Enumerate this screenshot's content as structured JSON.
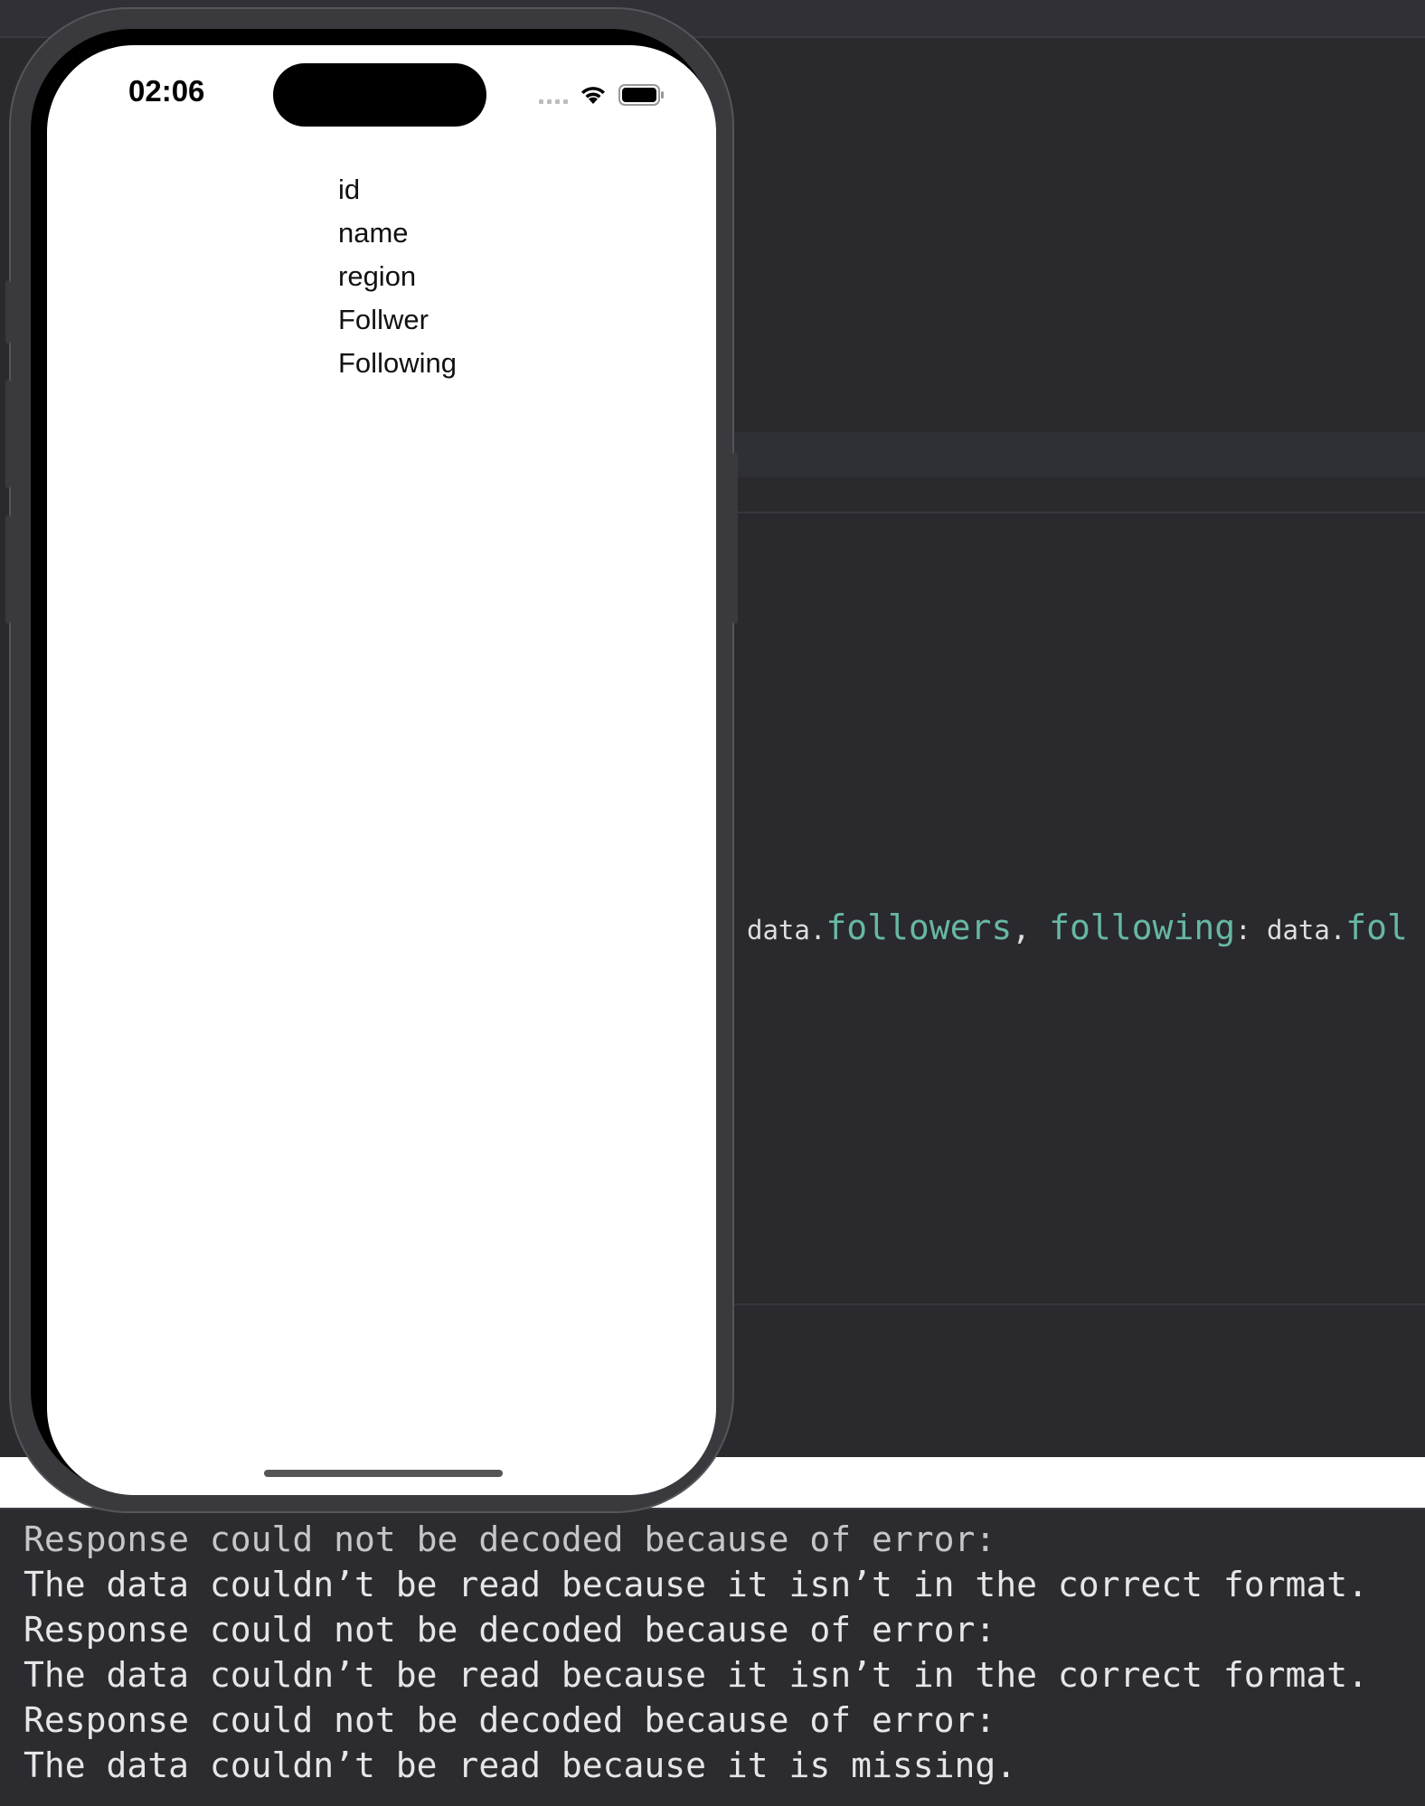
{
  "simulator": {
    "status_bar": {
      "time": "02:06",
      "icons": [
        "cellular-signal-icon",
        "wifi-icon",
        "battery-icon"
      ]
    },
    "fields": [
      "id",
      "name",
      "region",
      "Follwer",
      "Following"
    ]
  },
  "editor": {
    "code_line": {
      "part1": "data.",
      "part2": "followers",
      "part3": ", ",
      "part4": "following",
      "part5": ": data.",
      "part6": "fol"
    },
    "colors": {
      "background": "#29292e",
      "property": "#67b7a4",
      "text": "#dfdfe0"
    }
  },
  "console": {
    "lines": [
      "Response could not be decoded because of error:",
      "The data couldn’t be read because it isn’t in the correct format.",
      "Response could not be decoded because of error:",
      "The data couldn’t be read because it isn’t in the correct format.",
      "Response could not be decoded because of error:",
      "The data couldn’t be read because it is missing."
    ]
  }
}
